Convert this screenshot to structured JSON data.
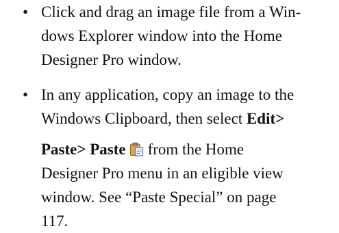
{
  "bullets": [
    {
      "marker": "•",
      "lines": [
        "Click and drag an image file from a Win-",
        "dows Explorer window into the Home",
        "Designer Pro window."
      ]
    },
    {
      "marker": "•",
      "line1": "In any application, copy an image to the",
      "line2_text": "Windows Clipboard, then select ",
      "line2_bold": "Edit>",
      "line3_bold": "Paste> Paste",
      "line3_icon": "paste-icon",
      "line3_text": "from the Home",
      "line4": "Designer Pro menu in an eligible view",
      "line5": "window. See “Paste Special” on page",
      "line6": "117."
    }
  ],
  "colors": {
    "text": "#111111",
    "clipboard_body": "#e8a33c",
    "clipboard_clip": "#8a8a8a",
    "paper": "#ffffff",
    "paper_border": "#4a79c4"
  }
}
